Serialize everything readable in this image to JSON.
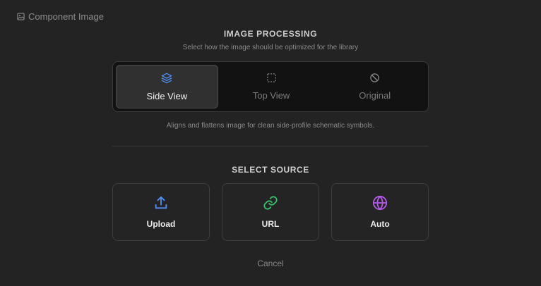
{
  "header": {
    "title": "Component Image",
    "icon": "image-icon"
  },
  "processing": {
    "title": "IMAGE PROCESSING",
    "subtitle": "Select how the image should be optimized for the library",
    "options": [
      {
        "label": "Side View",
        "icon": "layers-icon",
        "selected": true
      },
      {
        "label": "Top View",
        "icon": "dashed-square-icon",
        "selected": false
      },
      {
        "label": "Original",
        "icon": "ban-icon",
        "selected": false
      }
    ],
    "description": "Aligns and flattens image for clean side-profile schematic symbols."
  },
  "source": {
    "title": "SELECT SOURCE",
    "options": [
      {
        "label": "Upload",
        "icon": "upload-icon",
        "color": "#4f8ff7"
      },
      {
        "label": "URL",
        "icon": "link-icon",
        "color": "#36c26b"
      },
      {
        "label": "Auto",
        "icon": "globe-icon",
        "color": "#b35ae8"
      }
    ]
  },
  "footer": {
    "cancel_label": "Cancel"
  },
  "colors": {
    "background": "#232323",
    "accent_blue": "#4f8ff7"
  }
}
